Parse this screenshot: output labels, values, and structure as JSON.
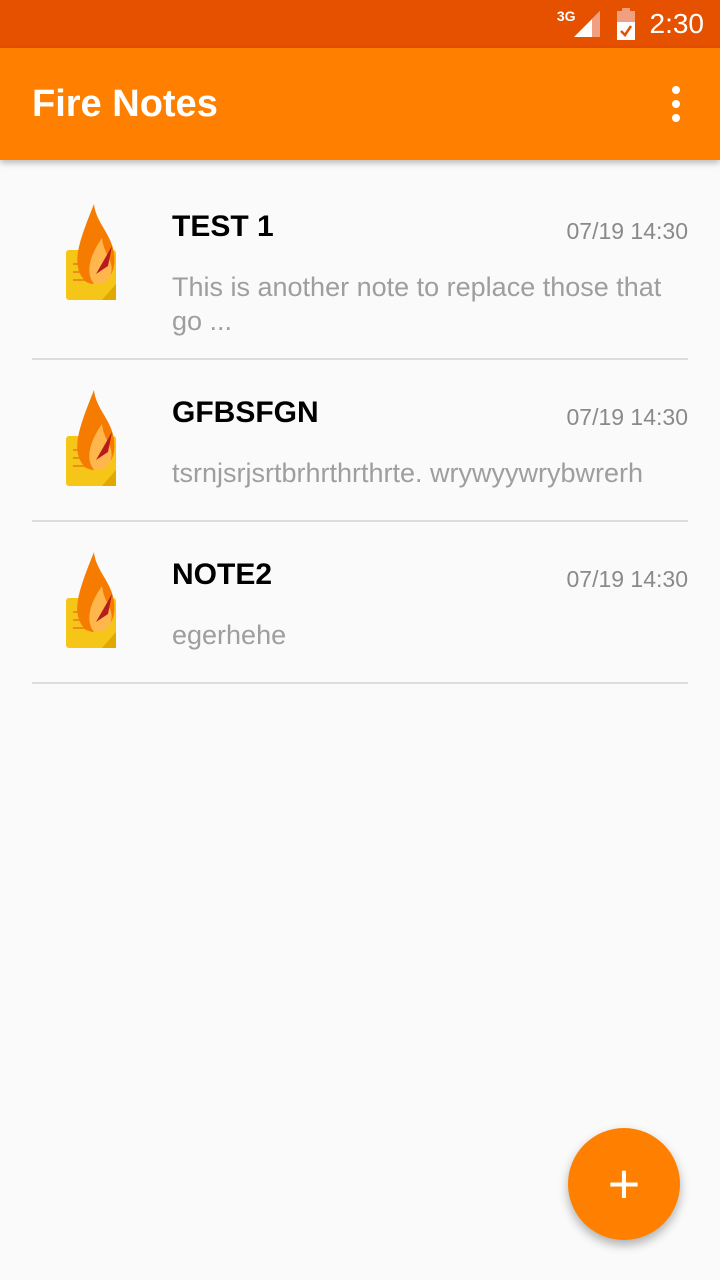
{
  "status_bar": {
    "network": "3G",
    "time": "2:30"
  },
  "app_bar": {
    "title": "Fire Notes"
  },
  "notes": [
    {
      "title": "TEST 1",
      "date": "07/19 14:30",
      "body": "This is another note to replace those that go ..."
    },
    {
      "title": "GFBSFGN",
      "date": "07/19 14:30",
      "body": "tsrnjsrjsrtbrhrthrthrte. wrywyywrybwrerh"
    },
    {
      "title": "NOTE2",
      "date": "07/19 14:30",
      "body": "egerhehe"
    }
  ],
  "fab": {
    "label": "+"
  },
  "colors": {
    "primary": "#ff8000",
    "status_bar": "#e65100",
    "background": "#fafafa"
  },
  "icons": {
    "note_icon": "fire-note-icon",
    "menu": "more-vert-icon",
    "fab": "plus-icon"
  }
}
